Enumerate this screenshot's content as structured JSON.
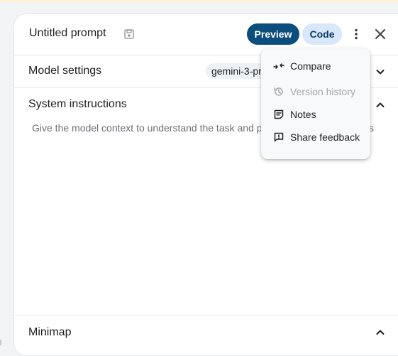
{
  "header": {
    "title": "Untitled prompt",
    "preview_label": "Preview",
    "code_label": "Code"
  },
  "model_settings": {
    "title": "Model settings",
    "model_chip": "gemini-3-pr"
  },
  "system_instructions": {
    "title": "System instructions",
    "placeholder": "Give the model context to understand the task and p",
    "placeholder_tail": "s"
  },
  "minimap": {
    "title": "Minimap"
  },
  "menu": {
    "items": [
      {
        "label": "Compare",
        "icon": "compare-icon",
        "disabled": false
      },
      {
        "label": "Version history",
        "icon": "history-icon",
        "disabled": true
      },
      {
        "label": "Notes",
        "icon": "notes-icon",
        "disabled": false
      },
      {
        "label": "Share feedback",
        "icon": "feedback-icon",
        "disabled": false
      }
    ]
  },
  "colors": {
    "preview_button": "#0b4d7c",
    "code_button": "#d9e7fb",
    "menu_background": "#f8f9fb",
    "border": "#e3e7ee"
  }
}
